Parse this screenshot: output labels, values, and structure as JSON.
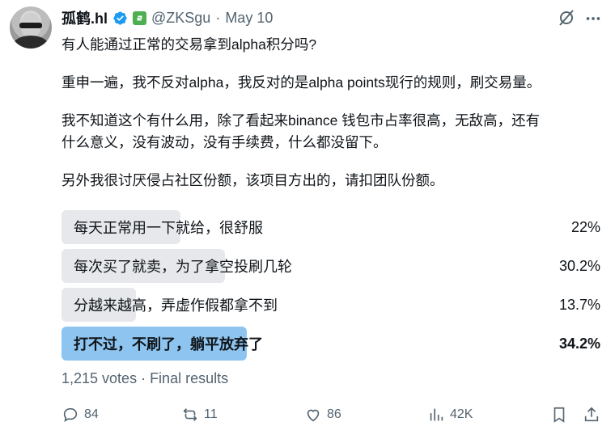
{
  "author": {
    "display_name": "孤鹤.hl",
    "handle": "@ZKSgu",
    "separator": "·",
    "date": "May 10"
  },
  "tweet": {
    "lines": [
      "有人能通过正常的交易拿到alpha积分吗?",
      "",
      "重申一遍，我不反对alpha，我反对的是alpha points现行的规则，刷交易量。",
      "",
      "我不知道这个有什么用，除了看起来binance 钱包市占率很高，无敌高，还有",
      "什么意义，没有波动，没有手续费，什么都没留下。",
      "",
      "另外我很讨厌侵占社区份额，该项目方出的，请扣团队份额。"
    ]
  },
  "poll": {
    "options": [
      {
        "label": "每天正常用一下就给，很舒服",
        "percent_text": "22%",
        "percent": 22.0,
        "winner": false
      },
      {
        "label": "每次买了就卖，为了拿空投刷几轮",
        "percent_text": "30.2%",
        "percent": 30.2,
        "winner": false
      },
      {
        "label": "分越来越高，弄虚作假都拿不到",
        "percent_text": "13.7%",
        "percent": 13.7,
        "winner": false
      },
      {
        "label": "打不过，不刷了，躺平放弃了",
        "percent_text": "34.2%",
        "percent": 34.2,
        "winner": true
      }
    ],
    "meta": "1,215 votes · Final results"
  },
  "actions": {
    "replies": "84",
    "reposts": "11",
    "likes": "86",
    "views": "42K"
  },
  "icons": {
    "verified": "verified-badge-icon",
    "affiliate": "affiliate-tag-icon",
    "grok": "grok-icon",
    "more": "more-icon",
    "reply": "reply-icon",
    "repost": "repost-icon",
    "like": "like-icon",
    "views": "views-icon",
    "bookmark": "bookmark-icon",
    "share": "share-icon"
  },
  "colors": {
    "accent": "#1d9bf0",
    "poll_bar": "#e6e8eb",
    "poll_winner_bar": "#8ec5f0",
    "muted_text": "#536471"
  }
}
